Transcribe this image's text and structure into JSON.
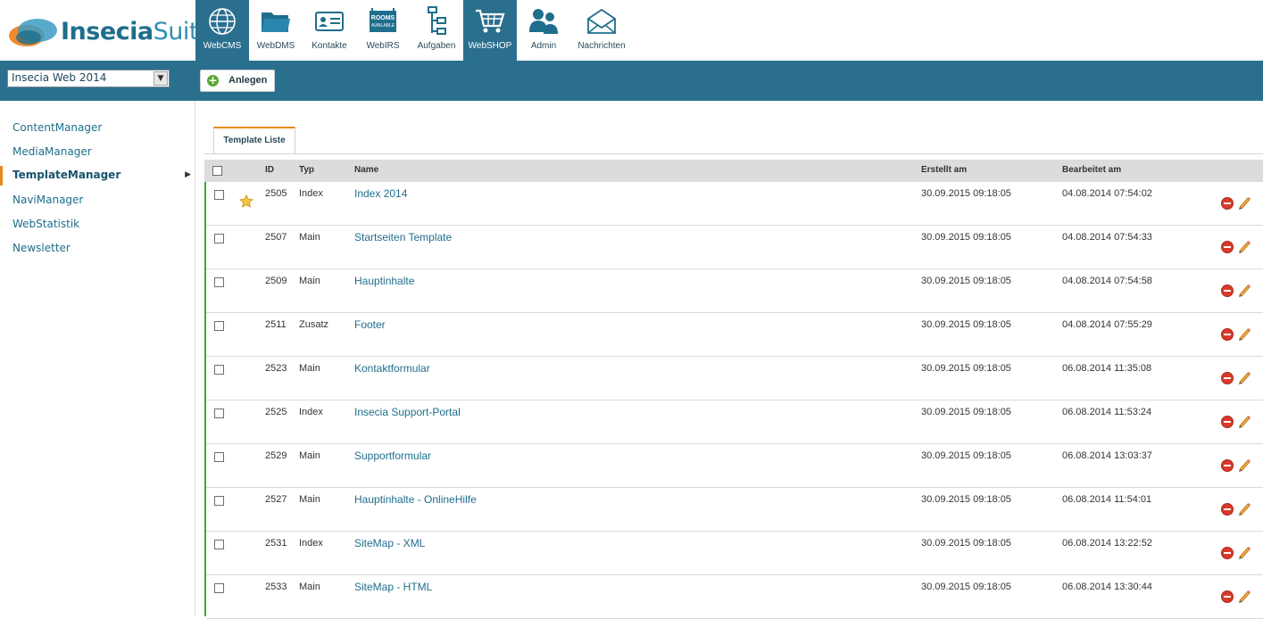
{
  "app": {
    "logo_part1": "Insecia",
    "logo_part2": "Suite"
  },
  "modules": [
    {
      "label": "WebCMS",
      "icon": "globe-icon",
      "active": true
    },
    {
      "label": "WebDMS",
      "icon": "folder-icon",
      "active": false
    },
    {
      "label": "Kontakte",
      "icon": "contact-card-icon",
      "active": false
    },
    {
      "label": "WebIRS",
      "icon": "rooms-available-icon",
      "active": false
    },
    {
      "label": "Aufgaben",
      "icon": "task-tree-icon",
      "active": false
    },
    {
      "label": "WebSHOP",
      "icon": "shopping-cart-icon",
      "active": true
    },
    {
      "label": "Admin",
      "icon": "users-icon",
      "active": false
    },
    {
      "label": "Nachrichten",
      "icon": "envelope-icon",
      "active": false
    }
  ],
  "rooms_icon_text": [
    "ROOMS",
    "AVAILABLE"
  ],
  "toolbar": {
    "site_select_value": "Insecia Web 2014",
    "anlegen_label": "Anlegen"
  },
  "sidebar": {
    "items": [
      {
        "label": "ContentManager",
        "active": false
      },
      {
        "label": "MediaManager",
        "active": false
      },
      {
        "label": "TemplateManager",
        "active": true
      },
      {
        "label": "NaviManager",
        "active": false
      },
      {
        "label": "WebStatistik",
        "active": false
      },
      {
        "label": "Newsletter",
        "active": false
      }
    ]
  },
  "tab": {
    "label": "Template Liste"
  },
  "table": {
    "columns": {
      "id": "ID",
      "typ": "Typ",
      "name": "Name",
      "erstellt": "Erstellt am",
      "bearbeitet": "Bearbeitet am"
    },
    "rows": [
      {
        "id": "2505",
        "typ": "Index",
        "name": "Index 2014",
        "erstellt": "30.09.2015 09:18:05",
        "bearbeitet": "04.08.2014 07:54:02",
        "starred": true
      },
      {
        "id": "2507",
        "typ": "Main",
        "name": "Startseiten Template",
        "erstellt": "30.09.2015 09:18:05",
        "bearbeitet": "04.08.2014 07:54:33",
        "starred": false
      },
      {
        "id": "2509",
        "typ": "Main",
        "name": "Hauptinhalte",
        "erstellt": "30.09.2015 09:18:05",
        "bearbeitet": "04.08.2014 07:54:58",
        "starred": false
      },
      {
        "id": "2511",
        "typ": "Zusatz",
        "name": "Footer",
        "erstellt": "30.09.2015 09:18:05",
        "bearbeitet": "04.08.2014 07:55:29",
        "starred": false
      },
      {
        "id": "2523",
        "typ": "Main",
        "name": "Kontaktformular",
        "erstellt": "30.09.2015 09:18:05",
        "bearbeitet": "06.08.2014 11:35:08",
        "starred": false
      },
      {
        "id": "2525",
        "typ": "Index",
        "name": "Insecia Support-Portal",
        "erstellt": "30.09.2015 09:18:05",
        "bearbeitet": "06.08.2014 11:53:24",
        "starred": false
      },
      {
        "id": "2529",
        "typ": "Main",
        "name": "Supportformular",
        "erstellt": "30.09.2015 09:18:05",
        "bearbeitet": "06.08.2014 13:03:37",
        "starred": false
      },
      {
        "id": "2527",
        "typ": "Main",
        "name": "Hauptinhalte - OnlineHilfe",
        "erstellt": "30.09.2015 09:18:05",
        "bearbeitet": "06.08.2014 11:54:01",
        "starred": false
      },
      {
        "id": "2531",
        "typ": "Index",
        "name": "SiteMap - XML",
        "erstellt": "30.09.2015 09:18:05",
        "bearbeitet": "06.08.2014 13:22:52",
        "starred": false
      },
      {
        "id": "2533",
        "typ": "Main",
        "name": "SiteMap - HTML",
        "erstellt": "30.09.2015 09:18:05",
        "bearbeitet": "06.08.2014 13:30:44",
        "starred": false
      }
    ]
  },
  "colors": {
    "brand_blue": "#2b6f8e",
    "link_teal": "#1f6e8c",
    "accent_orange": "#e68a1c",
    "row_marker_green": "#3aa63a",
    "delete_red": "#d93a2a"
  }
}
